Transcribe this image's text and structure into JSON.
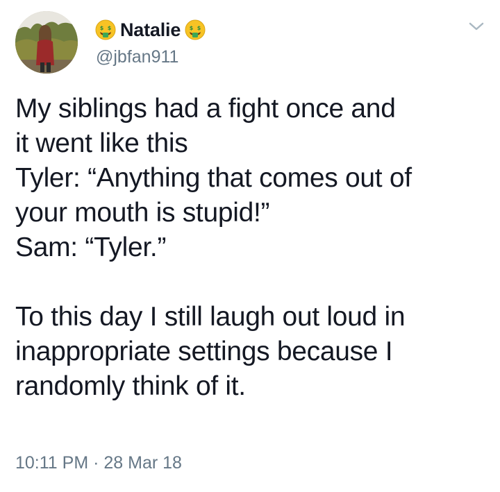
{
  "tweet": {
    "author": {
      "display_name": "Natalie",
      "handle": "@jbfan911",
      "name_emoji_left": "money-mouth-face-icon",
      "name_emoji_right": "money-mouth-face-icon"
    },
    "menu_icon": "chevron-down-icon",
    "text_lines_1": [
      "My siblings had a fight once and",
      "it went like this",
      "Tyler: “Anything that comes out of",
      "your mouth is stupid!”",
      "Sam: “Tyler.”"
    ],
    "text_lines_2": [
      "To this day I still laugh out loud in",
      "inappropriate settings because I",
      "randomly think of it."
    ],
    "timestamp": "10:11 PM · 28 Mar 18"
  },
  "colors": {
    "text": "#141823",
    "secondary": "#657786",
    "emoji_face": "#f7c325",
    "emoji_money": "#3aa757"
  }
}
